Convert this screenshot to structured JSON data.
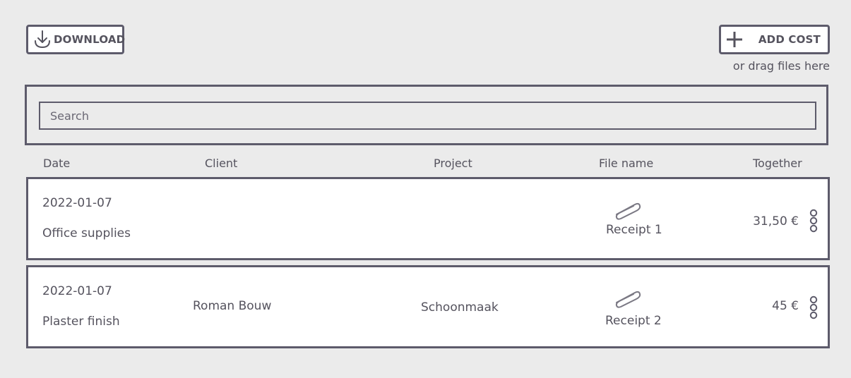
{
  "toolbar": {
    "download_label": "DOWNLOAD",
    "add_cost_label": "ADD COST",
    "drag_hint": "or drag files here"
  },
  "search": {
    "placeholder": "Search",
    "value": ""
  },
  "table": {
    "columns": [
      "Date",
      "Client",
      "Project",
      "File name",
      "Together"
    ],
    "rows": [
      {
        "date": "2022-01-07",
        "description": "Office supplies",
        "client": "",
        "project": "",
        "file_icon": "paperclip-icon",
        "file_name": "Receipt 1",
        "together": "31,50 €"
      },
      {
        "date": "2022-01-07",
        "description": "Plaster finish",
        "client": "Roman Bouw",
        "project": "Schoonmaak",
        "file_icon": "paperclip-icon",
        "file_name": "Receipt 2",
        "together": "45 €"
      }
    ]
  },
  "colors": {
    "border": "#5d5b6b",
    "text": "#55535e",
    "background": "#ebebeb",
    "row_background": "#ffffff"
  }
}
